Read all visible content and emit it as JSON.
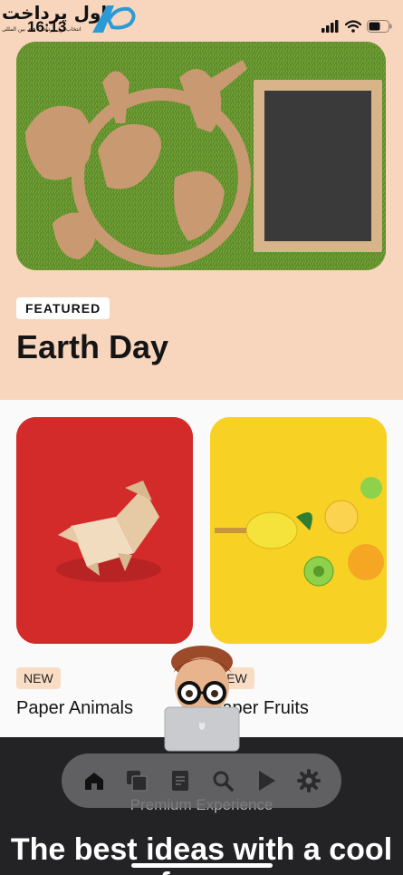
{
  "status_bar": {
    "time": "16:13",
    "watermark_text": "اول پرداخت",
    "watermark_subtext": "انتخاب اول پرداخت های بین المللی"
  },
  "hero": {
    "badge": "FEATURED",
    "title": "Earth Day"
  },
  "cards": [
    {
      "badge": "NEW",
      "title": "Paper Animals"
    },
    {
      "badge": "NEW",
      "title": "Paper Fruits"
    }
  ],
  "promo": {
    "subtitle": "Premium Experience",
    "title": "The best ideas with a cool frame"
  },
  "tab_bar": {
    "tabs": [
      "home-icon",
      "copy-icon",
      "book-icon",
      "search-icon",
      "play-icon",
      "settings-icon"
    ]
  },
  "colors": {
    "hero_background": "#f8d6bd",
    "card_red": "#d32a2a",
    "card_yellow": "#f7d225",
    "dark_section": "#232325",
    "badge_background": "#f9dcc4"
  }
}
